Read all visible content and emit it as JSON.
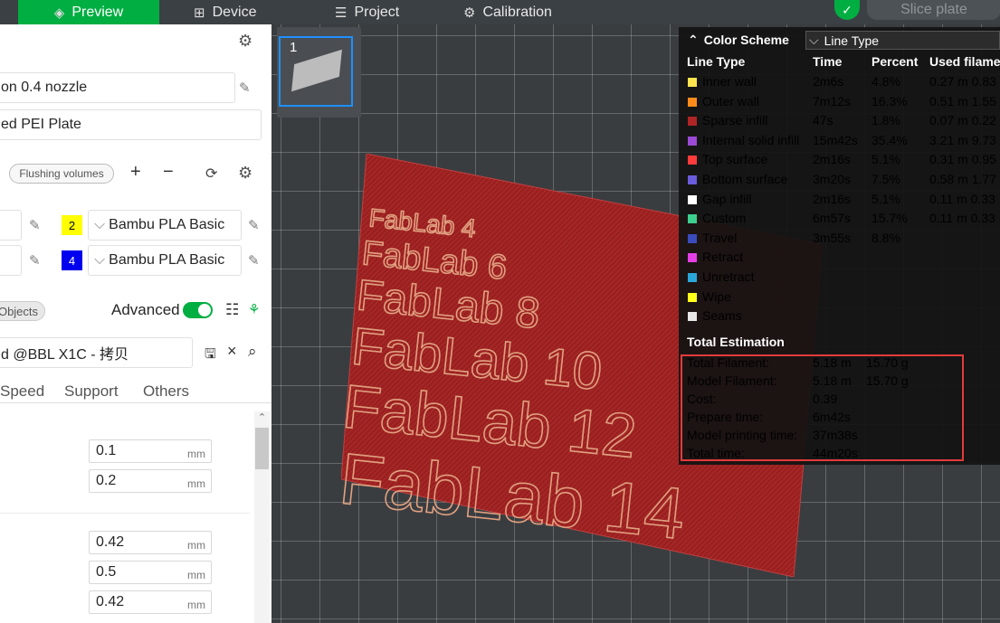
{
  "topbar": {
    "tabs": [
      {
        "label": "Preview"
      },
      {
        "label": "Device"
      },
      {
        "label": "Project"
      },
      {
        "label": "Calibration"
      }
    ],
    "slice_label": "Slice plate"
  },
  "sidebar": {
    "printer": "on 0.4 nozzle",
    "plate": "ed PEI Plate",
    "flushing": "Flushing volumes",
    "filaments": [
      {
        "num": "2",
        "name": "Bambu PLA Basic",
        "color": "#ffff00"
      },
      {
        "num": "4",
        "name": "Bambu PLA Basic",
        "color": "#0000ee"
      }
    ],
    "objects_label": "Objects",
    "advanced_label": "Advanced",
    "process": "d @BBL X1C - 拷贝",
    "subtabs": [
      "Speed",
      "Support",
      "Others"
    ],
    "values": [
      {
        "v": "0.1",
        "u": "mm"
      },
      {
        "v": "0.2",
        "u": "mm"
      },
      {
        "v": "0.42",
        "u": "mm"
      },
      {
        "v": "0.5",
        "u": "mm"
      },
      {
        "v": "0.42",
        "u": "mm"
      }
    ]
  },
  "thumb": {
    "number": "1"
  },
  "plate": {
    "labels": [
      "FabLab 4",
      "FabLab 6",
      "FabLab 8",
      "FabLab 10",
      "FabLab 12",
      "FabLab 14"
    ]
  },
  "legend": {
    "title": "Color Scheme",
    "scheme": "Line Type",
    "headers": [
      "Line Type",
      "Time",
      "Percent",
      "Used filame"
    ],
    "rows": [
      {
        "name": "Inner wall",
        "color": "#ffe44d",
        "time": "2m6s",
        "pct": "4.8%",
        "used": "0.27 m  0.83"
      },
      {
        "name": "Outer wall",
        "color": "#ff8c1a",
        "time": "7m12s",
        "pct": "16.3%",
        "used": "0.51 m  1.55"
      },
      {
        "name": "Sparse infill",
        "color": "#b02525",
        "time": "47s",
        "pct": "1.8%",
        "used": "0.07 m  0.22"
      },
      {
        "name": "Internal solid infill",
        "color": "#9b49d6",
        "time": "15m42s",
        "pct": "35.4%",
        "used": "3.21 m  9.73"
      },
      {
        "name": "Top surface",
        "color": "#ff3b3b",
        "time": "2m16s",
        "pct": "5.1%",
        "used": "0.31 m  0.95"
      },
      {
        "name": "Bottom surface",
        "color": "#6a5cdb",
        "time": "3m20s",
        "pct": "7.5%",
        "used": "0.58 m  1.77"
      },
      {
        "name": "Gap infill",
        "color": "#ffffff",
        "time": "2m16s",
        "pct": "5.1%",
        "used": "0.11 m  0.33"
      },
      {
        "name": "Custom",
        "color": "#3ccf8e",
        "time": "6m57s",
        "pct": "15.7%",
        "used": "0.11 m  0.33"
      },
      {
        "name": "Travel",
        "color": "#3a4bbd",
        "time": "3m55s",
        "pct": "8.8%",
        "used": ""
      },
      {
        "name": "Retract",
        "color": "#e63ee6",
        "time": "",
        "pct": "",
        "used": ""
      },
      {
        "name": "Unretract",
        "color": "#2aa7d9",
        "time": "",
        "pct": "",
        "used": ""
      },
      {
        "name": "Wipe",
        "color": "#ffff1a",
        "time": "",
        "pct": "",
        "used": ""
      },
      {
        "name": "Seams",
        "color": "#e6e6e6",
        "time": "",
        "pct": "",
        "used": ""
      }
    ],
    "total_title": "Total Estimation",
    "totals": [
      {
        "label": "Total Filament:",
        "v1": "5.18 m",
        "v2": "15.70 g"
      },
      {
        "label": "Model Filament:",
        "v1": "5.18 m",
        "v2": "15.70 g"
      },
      {
        "label": "Cost:",
        "v1": "0.39",
        "v2": ""
      },
      {
        "label": "Prepare time:",
        "v1": "6m42s",
        "v2": ""
      },
      {
        "label": "Model printing time:",
        "v1": "37m38s",
        "v2": ""
      },
      {
        "label": "Total time:",
        "v1": "44m20s",
        "v2": ""
      }
    ]
  }
}
